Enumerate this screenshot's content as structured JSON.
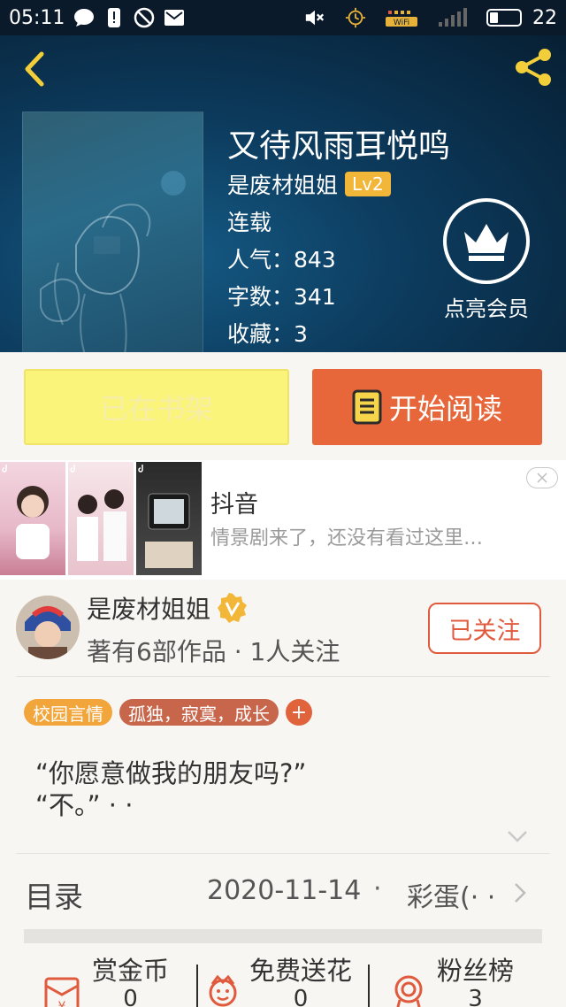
{
  "status_bar": {
    "time": "05:11",
    "battery": "22",
    "wifi_label": "WiFi"
  },
  "book": {
    "title": "又待风雨耳悦鸣",
    "author": "是废材姐姐",
    "level": "Lv2",
    "status": "连载",
    "popularity_label": "人气：",
    "popularity": "843",
    "words_label": "字数：",
    "words": "341",
    "favorites_label": "收藏：",
    "favorites": "3"
  },
  "member": {
    "label": "点亮会员"
  },
  "actions": {
    "shelf_label": "已在书架",
    "read_label": "开始阅读"
  },
  "ad": {
    "title": "抖音",
    "desc": "情景剧来了，还没有看过这里…"
  },
  "author_section": {
    "name": "是废材姐姐",
    "stats": "著有6部作品 · 1人关注",
    "follow_label": "已关注"
  },
  "tags": {
    "genre": "校园言情",
    "keywords": "孤独，寂寞，成长",
    "add": "+"
  },
  "synopsis": {
    "line1": "“你愿意做我的朋友吗?”",
    "line2": "“不。” · ·"
  },
  "catalog": {
    "label": "目录",
    "date": "2020-11-14",
    "dot": "·",
    "latest": "彩蛋(· ·"
  },
  "bottom": {
    "reward_label": "赏金币",
    "reward_count": "0",
    "flower_label": "免费送花",
    "flower_count": "0",
    "fans_label": "粉丝榜",
    "fans_count": "3"
  },
  "colors": {
    "accent_orange": "#e7673a",
    "shelf_yellow": "#fbf47a",
    "level_badge": "#f2b638"
  }
}
